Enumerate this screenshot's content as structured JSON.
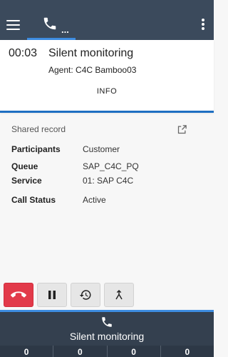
{
  "topbar": {
    "tab_dots": "...",
    "icons": {
      "menu": "hamburger-icon",
      "tab": "phone-icon",
      "more": "kebab-icon"
    }
  },
  "call": {
    "timer": "00:03",
    "title": "Silent monitoring",
    "agent": "Agent: C4C Bamboo03",
    "info_tab": "INFO"
  },
  "details": {
    "shared_record": "Shared record",
    "rows": [
      {
        "label": "Participants",
        "value": "Customer"
      },
      {
        "label": "Queue",
        "value": "SAP_C4C_PQ"
      },
      {
        "label": "Service",
        "value": "01: SAP C4C"
      },
      {
        "label": "Call Status",
        "value": "Active"
      }
    ]
  },
  "actions": {
    "icons": [
      "hang-up-icon",
      "pause-icon",
      "history-icon",
      "merge-icon"
    ]
  },
  "bottom": {
    "title": "Silent monitoring",
    "counters": [
      "0",
      "0",
      "0",
      "0"
    ]
  },
  "colors": {
    "topbar": "#3b4a5c",
    "accent": "#3d8ce0",
    "header_border": "#1e6fc2",
    "hangup": "#e23a4a",
    "bottom_bar": "#34404f"
  }
}
